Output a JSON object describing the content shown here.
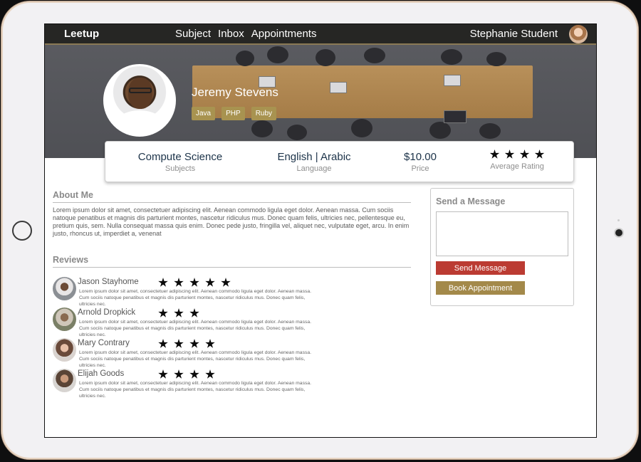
{
  "nav": {
    "brand": "Leetup",
    "links": [
      "Subject",
      "Inbox",
      "Appointments"
    ],
    "user_name": "Stephanie Student"
  },
  "profile": {
    "name": "Jeremy Stevens",
    "tags": [
      "Java",
      "PHP",
      "Ruby"
    ]
  },
  "stats": {
    "subject_value": "Compute Science",
    "subject_label": "Subjects",
    "language_value": "English | Arabic",
    "language_label": "Language",
    "price_value": "$10.00",
    "price_label": "Price",
    "rating_label": "Average Rating",
    "rating_stars": 4
  },
  "about": {
    "title": "About Me",
    "text": "Lorem ipsum dolor sit amet, consectetuer adipiscing elit. Aenean commodo ligula eget dolor. Aenean massa. Cum sociis natoque penatibus et magnis dis parturient montes, nascetur ridiculus mus. Donec quam felis, ultricies nec, pellentesque eu, pretium quis, sem. Nulla consequat massa quis enim. Donec pede justo, fringilla vel, aliquet nec, vulputate eget, arcu. In enim justo, rhoncus ut, imperdiet a, venenat"
  },
  "reviews": {
    "title": "Reviews",
    "items": [
      {
        "name": "Jason Stayhome",
        "stars": 5,
        "text": "Lorem ipsum dolor sit amet, consectetuer adipiscing elit. Aenean commodo ligula eget dolor. Aenean massa. Cum sociis natoque penatibus et magnis dis parturient montes, nascetur ridiculus mus. Donec quam felis, ultricies nec."
      },
      {
        "name": "Arnold Dropkick",
        "stars": 3,
        "text": "Lorem ipsum dolor sit amet, consectetuer adipiscing elit. Aenean commodo ligula eget dolor. Aenean massa. Cum sociis natoque penatibus et magnis dis parturient montes, nascetur ridiculus mus. Donec quam felis, ultricies nec."
      },
      {
        "name": "Mary Contrary",
        "stars": 4,
        "text": "Lorem ipsum dolor sit amet, consectetuer adipiscing elit. Aenean commodo ligula eget dolor. Aenean massa. Cum sociis natoque penatibus et magnis dis parturient montes, nascetur ridiculus mus. Donec quam felis, ultricies nec."
      },
      {
        "name": "Elijah Goods",
        "stars": 4,
        "text": "Lorem ipsum dolor sit amet, consectetuer adipiscing elit. Aenean commodo ligula eget dolor. Aenean massa. Cum sociis natoque penatibus et magnis dis parturient montes, nascetur ridiculus mus. Donec quam felis, ultricies nec."
      }
    ]
  },
  "message": {
    "title": "Send a Message",
    "input_value": "",
    "send_label": "Send Message",
    "book_label": "Book Appointment"
  },
  "colors": {
    "nav_bg": "#262624",
    "tag_gold": "#a89350",
    "send_red": "#bb3b32",
    "book_gold": "#a3894a",
    "stat_text": "#1c3349"
  },
  "icons": [
    "user-avatar-photo",
    "profile-photo",
    "star-icon",
    "reviewer-avatar"
  ]
}
